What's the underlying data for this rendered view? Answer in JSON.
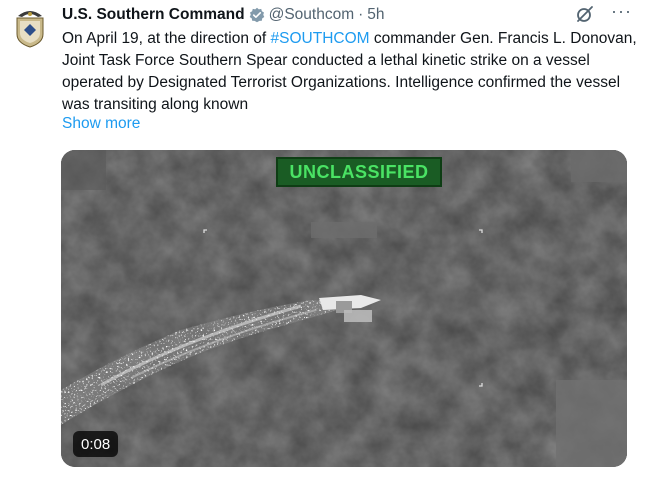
{
  "author": {
    "name": "U.S. Southern Command",
    "handle": "@Southcom",
    "separator": "·",
    "time": "5h",
    "verified_icon": "verified-badge-icon",
    "avatar_icon": "southcom-seal-icon"
  },
  "tweet": {
    "text_before_hashtag": "On April 19, at the direction of ",
    "hashtag": "#SOUTHCOM",
    "text_after_hashtag": " commander Gen. Francis L. Donovan, Joint Task Force Southern Spear conducted a lethal kinetic strike on a vessel operated by Designated Terrorist Organizations. Intelligence confirmed the vessel was transiting along known",
    "show_more": "Show more"
  },
  "media": {
    "type": "video",
    "overlay_label": "UNCLASSIFIED",
    "duration": "0:08"
  },
  "colors": {
    "link": "#1d9bf0",
    "muted": "#536471",
    "badge_text": "#4ae364",
    "badge_bg": "#1a5c24"
  }
}
